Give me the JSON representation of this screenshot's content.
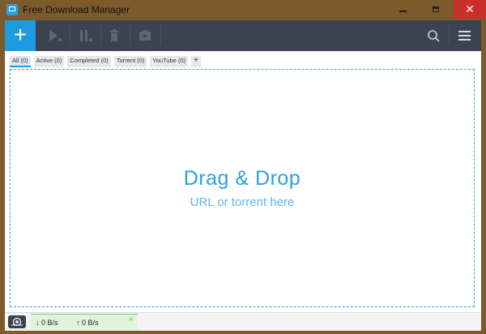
{
  "window": {
    "title": "Free Download Manager",
    "close_glyph": "✕"
  },
  "toolbar": {
    "add_glyph": "+",
    "icons": [
      "play-icon",
      "pause-icon",
      "trash-icon",
      "folder-icon",
      "search-icon",
      "menu-icon"
    ]
  },
  "tabs": [
    {
      "label": "All (0)",
      "active": true
    },
    {
      "label": "Active (0)"
    },
    {
      "label": "Completed (0)"
    },
    {
      "label": "Torrent (0)"
    },
    {
      "label": "YouTube (0)"
    }
  ],
  "tab_add_glyph": "+",
  "drop": {
    "title": "Drag & Drop",
    "subtitle": "URL or torrent here"
  },
  "status": {
    "download_speed": "↓  0 B/s",
    "upload_speed": "↑  0 B/s",
    "expand_glyph": "^"
  },
  "colors": {
    "accent": "#1e9ae0",
    "toolbar_bg": "#3b4351",
    "close_btn": "#c9302c",
    "frame": "#7d5a2c"
  }
}
